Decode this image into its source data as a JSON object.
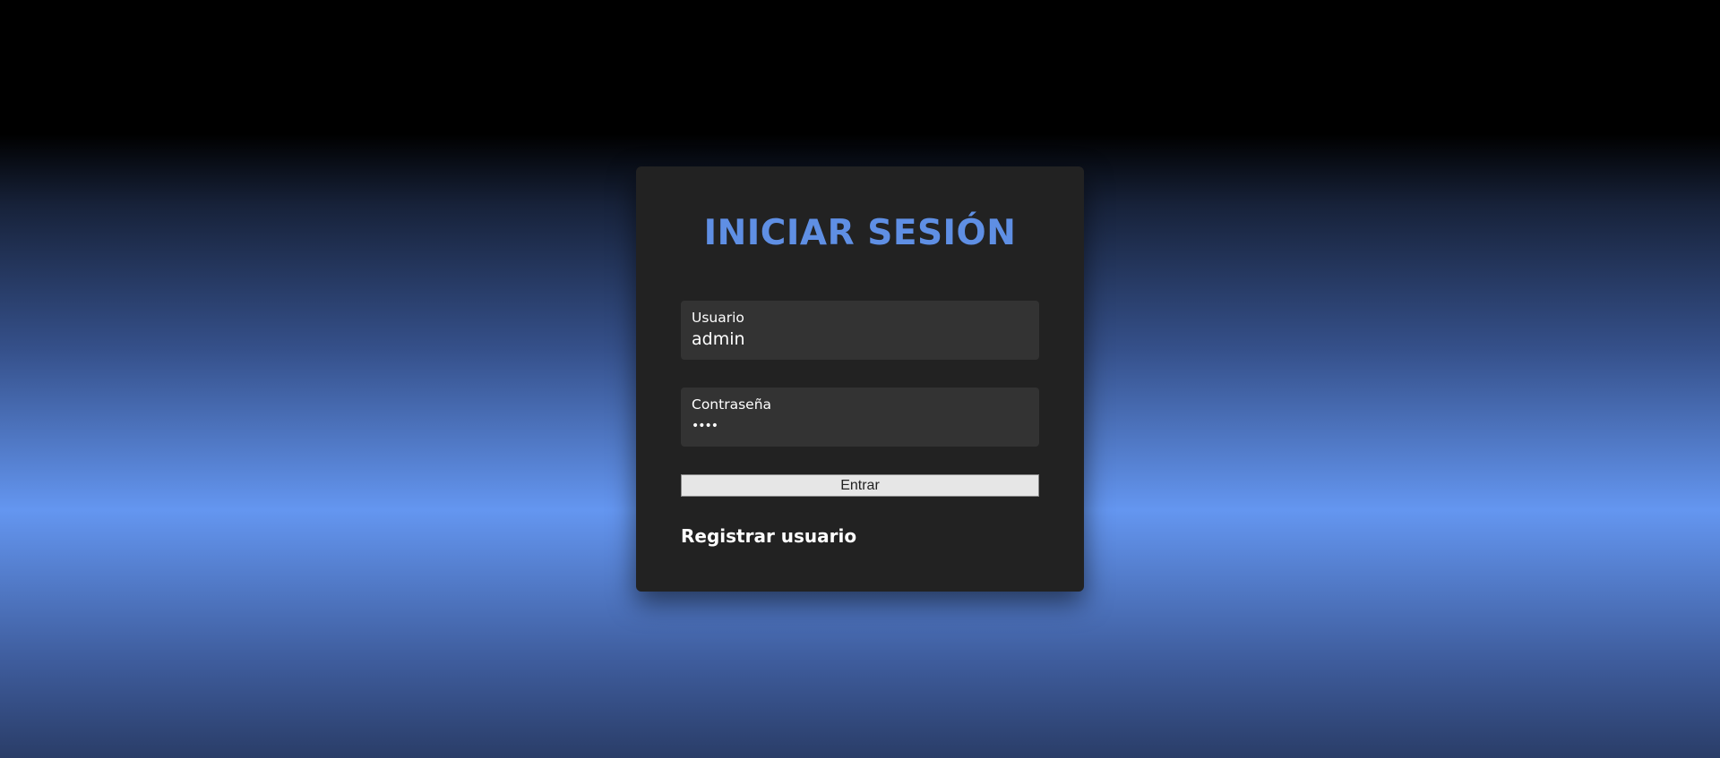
{
  "login": {
    "title": "INICIAR SESIÓN",
    "username_label": "Usuario",
    "username_value": "admin",
    "password_label": "Contraseña",
    "password_value": "••••",
    "submit_label": "Entrar",
    "register_link": "Registrar usuario"
  },
  "colors": {
    "accent": "#5f8fe4",
    "card_background": "#222222",
    "field_background": "#333333"
  }
}
